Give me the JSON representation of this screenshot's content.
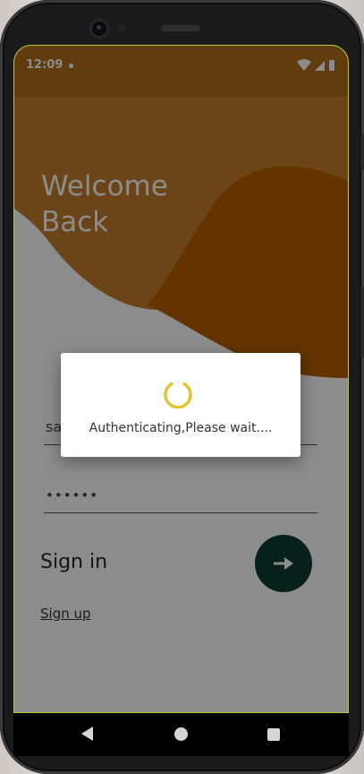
{
  "status_bar": {
    "time": "12:09",
    "icons": [
      "notification-dot-icon",
      "wifi-icon",
      "cellular-signal-icon",
      "battery-icon"
    ]
  },
  "app": {
    "welcome_line1": "Welcome",
    "welcome_line2": "Back",
    "username_value": "sa",
    "password_value": "••••••",
    "signin_label": "Sign in",
    "signup_link": "Sign up"
  },
  "dialog": {
    "message": "Authenticating,Please wait...."
  },
  "nav_bar": {
    "buttons": [
      "back-icon",
      "home-icon",
      "recents-icon"
    ]
  },
  "colors": {
    "brand_orange": "#b06d1d",
    "dark_orange": "#b75d00",
    "signin_button": "#0c3b32",
    "spinner": "#e2c431"
  }
}
